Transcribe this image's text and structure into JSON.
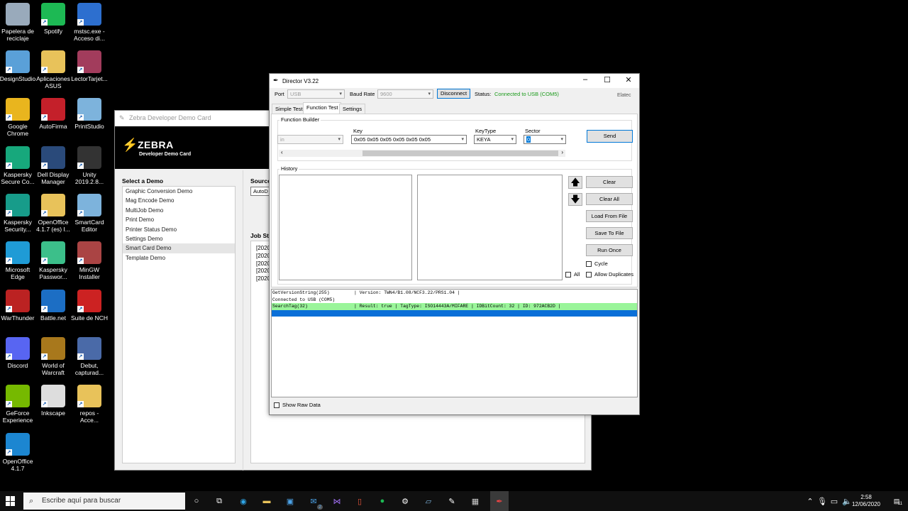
{
  "desktop_icons": [
    {
      "label": "Papelera de reciclaje",
      "icon": "recycle-bin-icon",
      "color": "#9ab"
    },
    {
      "label": "Spotify",
      "icon": "spotify-icon",
      "color": "#1db954"
    },
    {
      "label": "mstsc.exe - Acceso di...",
      "icon": "remote-desktop-icon",
      "color": "#2d6fcf"
    },
    {
      "label": "DesignStudio",
      "icon": "design-studio-icon",
      "color": "#5aa0d8"
    },
    {
      "label": "Aplicaciones ASUS",
      "icon": "folder-icon",
      "color": "#e8c25a"
    },
    {
      "label": "LectorTarjet...",
      "icon": "winrar-icon",
      "color": "#a23c5c"
    },
    {
      "label": "Google Chrome",
      "icon": "chrome-icon",
      "color": "#e9b51e"
    },
    {
      "label": "AutoFirma",
      "icon": "autofirma-icon",
      "color": "#c4202a"
    },
    {
      "label": "PrintStudio",
      "icon": "print-studio-icon",
      "color": "#7db3dc"
    },
    {
      "label": "Kaspersky Secure Co...",
      "icon": "kaspersky-icon",
      "color": "#17a87c"
    },
    {
      "label": "Dell Display Manager",
      "icon": "monitor-icon",
      "color": "#2a4a7a"
    },
    {
      "label": "Unity 2019.2.8...",
      "icon": "unity-icon",
      "color": "#333"
    },
    {
      "label": "Kaspersky Security...",
      "icon": "kaspersky-icon",
      "color": "#179c8a"
    },
    {
      "label": "OpenOffice 4.1.7 (es) I...",
      "icon": "folder-icon",
      "color": "#e8c25a"
    },
    {
      "label": "SmartCard Editor",
      "icon": "smartcard-icon",
      "color": "#7db3dc"
    },
    {
      "label": "Microsoft Edge",
      "icon": "edge-icon",
      "color": "#1f9bd6"
    },
    {
      "label": "Kaspersky Passwor...",
      "icon": "key-icon",
      "color": "#3cbf8a"
    },
    {
      "label": "MinGW Installer",
      "icon": "mingw-icon",
      "color": "#aa4444"
    },
    {
      "label": "WarThunder",
      "icon": "warthunder-icon",
      "color": "#b22"
    },
    {
      "label": "Battle.net",
      "icon": "battlenet-icon",
      "color": "#1c6ec4"
    },
    {
      "label": "Suite de NCH",
      "icon": "nch-icon",
      "color": "#c22"
    },
    {
      "label": "Discord",
      "icon": "discord-icon",
      "color": "#5865f2"
    },
    {
      "label": "World of Warcraft",
      "icon": "wow-icon",
      "color": "#a8781c"
    },
    {
      "label": "Debut, capturad...",
      "icon": "film-icon",
      "color": "#4a6aa8"
    },
    {
      "label": "GeForce Experience",
      "icon": "nvidia-icon",
      "color": "#76b900"
    },
    {
      "label": "Inkscape",
      "icon": "inkscape-icon",
      "color": "#ddd"
    },
    {
      "label": "repos - Acce...",
      "icon": "folder-icon",
      "color": "#e8c25a"
    },
    {
      "label": "OpenOffice 4.1.7",
      "icon": "openoffice-icon",
      "color": "#1c86d1"
    }
  ],
  "zebra": {
    "title": "Zebra Developer Demo Card",
    "brand": "ZEBRA",
    "brand_sub": "Developer Demo Card",
    "select_label": "Select a Demo",
    "source_label": "Source",
    "source_value": "AutoD",
    "job_label": "Job Sta",
    "job_lines": [
      "[2020",
      "[2020",
      "[2020",
      "[2020",
      "[2020"
    ],
    "demos": [
      "Graphic Conversion Demo",
      "Mag Encode Demo",
      "MultiJob Demo",
      "Print Demo",
      "Printer Status Demo",
      "Settings Demo",
      "Smart Card Demo",
      "Template Demo"
    ],
    "selected_demo": "Smart Card Demo"
  },
  "director": {
    "title": "Director V3.22",
    "port_label": "Port",
    "port_value": "USB",
    "baud_label": "Baud Rate",
    "baud_value": "9600",
    "disconnect": "Disconnect",
    "status_label": "Status:",
    "status_value": "Connected to USB (COM5)",
    "status_color": "#1a9a1a",
    "brand": "Elatec",
    "tabs": [
      "Simple Test",
      "Function Test",
      "Settings"
    ],
    "active_tab": "Function Test",
    "function_builder": "Function Builder",
    "fn_value": "in",
    "key_label": "Key",
    "key_value": "0x05 0x05 0x05 0x05 0x05 0x05",
    "keytype_label": "KeyType",
    "keytype_value": "KEYA",
    "sector_label": "Sector",
    "sector_value": "0",
    "send": "Send",
    "history": "History",
    "buttons": {
      "clear": "Clear",
      "clear_all": "Clear All",
      "load": "Load From File",
      "save": "Save To File",
      "run_once": "Run Once"
    },
    "cycle": "Cycle",
    "all": "All",
    "allow_duplicates": "Allow Duplicates",
    "log": [
      {
        "text": "GetVersionString(255)         | Version: TWN4/B1.08/NCF3.22/PRS1.04 |",
        "bg": "#ffffff",
        "color": "#000000"
      },
      {
        "text": "Connected to USB (COM5)",
        "bg": "#ffffff",
        "color": "#000000"
      },
      {
        "text": "SearchTag(32)                 | Result: true | TagType: ISO14443A/MIFARE | IDBitCount: 32 | ID: 972ACB2D |",
        "bg": "#9af59a",
        "color": "#000000"
      },
      {
        "text": "",
        "bg": "#0a6fd8",
        "color": "#ffffff"
      }
    ],
    "show_raw": "Show Raw Data"
  },
  "taskbar": {
    "search_placeholder": "Escribe aquí para buscar",
    "time": "2:58",
    "date": "12/06/2020",
    "notif_count": "11",
    "mail_badge": "2"
  }
}
